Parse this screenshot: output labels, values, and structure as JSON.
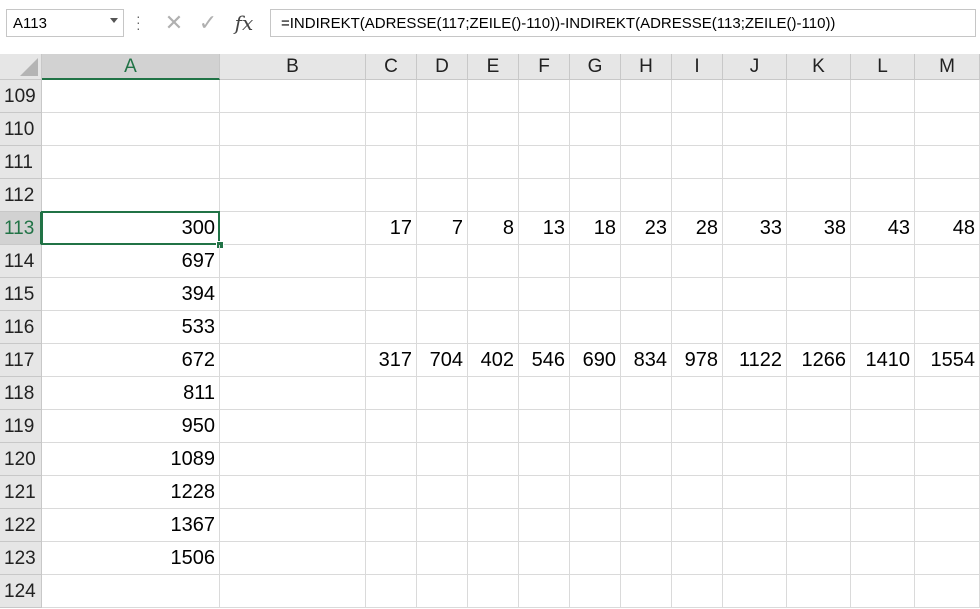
{
  "formula_bar": {
    "name_box": "A113",
    "cancel_icon": "x-icon",
    "enter_icon": "check-icon",
    "fx_label": "fx",
    "formula": "=INDIREKT(ADRESSE(117;ZEILE()-110))-INDIREKT(ADRESSE(113;ZEILE()-110))"
  },
  "columns": [
    "A",
    "B",
    "C",
    "D",
    "E",
    "F",
    "G",
    "H",
    "I",
    "J",
    "K",
    "L",
    "M"
  ],
  "selected_column": "A",
  "selected_row": "113",
  "rows": [
    {
      "num": "109",
      "cells": {}
    },
    {
      "num": "110",
      "cells": {}
    },
    {
      "num": "111",
      "cells": {}
    },
    {
      "num": "112",
      "cells": {}
    },
    {
      "num": "113",
      "cells": {
        "A": "300",
        "C": "17",
        "D": "7",
        "E": "8",
        "F": "13",
        "G": "18",
        "H": "23",
        "I": "28",
        "J": "33",
        "K": "38",
        "L": "43",
        "M": "48"
      }
    },
    {
      "num": "114",
      "cells": {
        "A": "697"
      }
    },
    {
      "num": "115",
      "cells": {
        "A": "394"
      }
    },
    {
      "num": "116",
      "cells": {
        "A": "533"
      }
    },
    {
      "num": "117",
      "cells": {
        "A": "672",
        "C": "317",
        "D": "704",
        "E": "402",
        "F": "546",
        "G": "690",
        "H": "834",
        "I": "978",
        "J": "1122",
        "K": "1266",
        "L": "1410",
        "M": "1554"
      }
    },
    {
      "num": "118",
      "cells": {
        "A": "811"
      }
    },
    {
      "num": "119",
      "cells": {
        "A": "950"
      }
    },
    {
      "num": "120",
      "cells": {
        "A": "1089"
      }
    },
    {
      "num": "121",
      "cells": {
        "A": "1228"
      }
    },
    {
      "num": "122",
      "cells": {
        "A": "1367"
      }
    },
    {
      "num": "123",
      "cells": {
        "A": "1506"
      }
    },
    {
      "num": "124",
      "cells": {}
    }
  ]
}
